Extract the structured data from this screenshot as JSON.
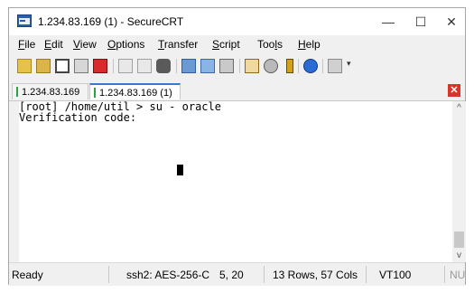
{
  "window": {
    "title": "1.234.83.169 (1) - SecureCRT"
  },
  "window_controls": {
    "minimize": "—",
    "maximize": "☐",
    "close": "✕"
  },
  "menu": [
    {
      "first": "F",
      "rest": "ile"
    },
    {
      "first": "E",
      "rest": "dit"
    },
    {
      "first": "V",
      "rest": "iew"
    },
    {
      "first": "O",
      "rest": "ptions"
    },
    {
      "first": "T",
      "rest": "ransfer"
    },
    {
      "first": "S",
      "rest": "cript"
    },
    {
      "pre": "Too",
      "first": "l",
      "rest": "s"
    },
    {
      "first": "H",
      "rest": "elp"
    }
  ],
  "tabs": [
    {
      "label": "1.234.83.169"
    },
    {
      "label": "1.234.83.169 (1)"
    }
  ],
  "close_tab_label": "✕",
  "terminal": {
    "lines": [
      "[root] /home/util > su - oracle",
      "Verification code:"
    ]
  },
  "scrollbar": {
    "up_arrow": "^",
    "down_arrow": "v"
  },
  "status": {
    "state": "Ready",
    "connection": "ssh2: AES-256-C",
    "position": "5, 20",
    "size": "13 Rows, 57 Cols",
    "terminal_type": "VT100",
    "mode": "NU"
  }
}
